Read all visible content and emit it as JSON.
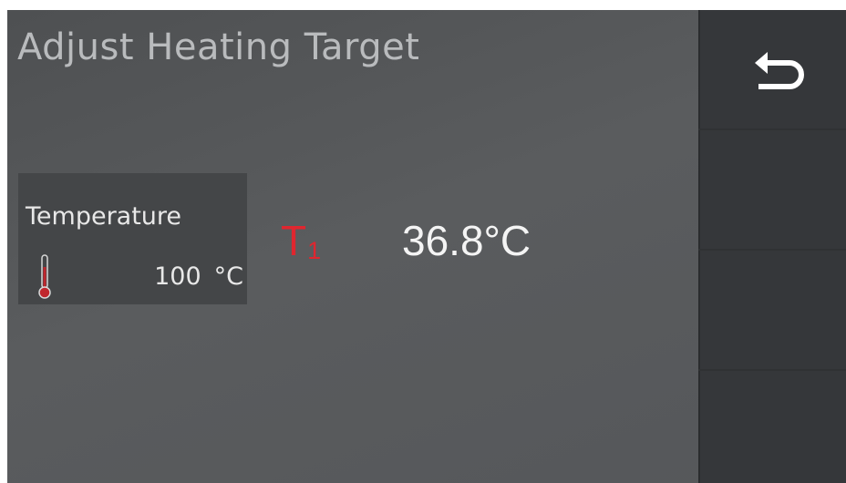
{
  "page": {
    "title": "Adjust Heating Target"
  },
  "temperature_card": {
    "label": "Temperature",
    "icon": "thermometer-icon",
    "value": "100",
    "unit": "°C"
  },
  "setpoint": {
    "symbol": "T",
    "subscript": "1",
    "symbol_color": "#e0262f",
    "current_value": "36.8°C"
  },
  "side_panel": {
    "buttons": [
      {
        "icon": "back-arrow-icon",
        "label": ""
      },
      {
        "icon": "",
        "label": ""
      },
      {
        "icon": "",
        "label": ""
      },
      {
        "icon": "",
        "label": ""
      }
    ]
  },
  "colors": {
    "background": "#55575a",
    "side_panel": "#303234",
    "card": "#444648",
    "accent_red": "#e0262f",
    "thermometer_red": "#c0272d"
  }
}
